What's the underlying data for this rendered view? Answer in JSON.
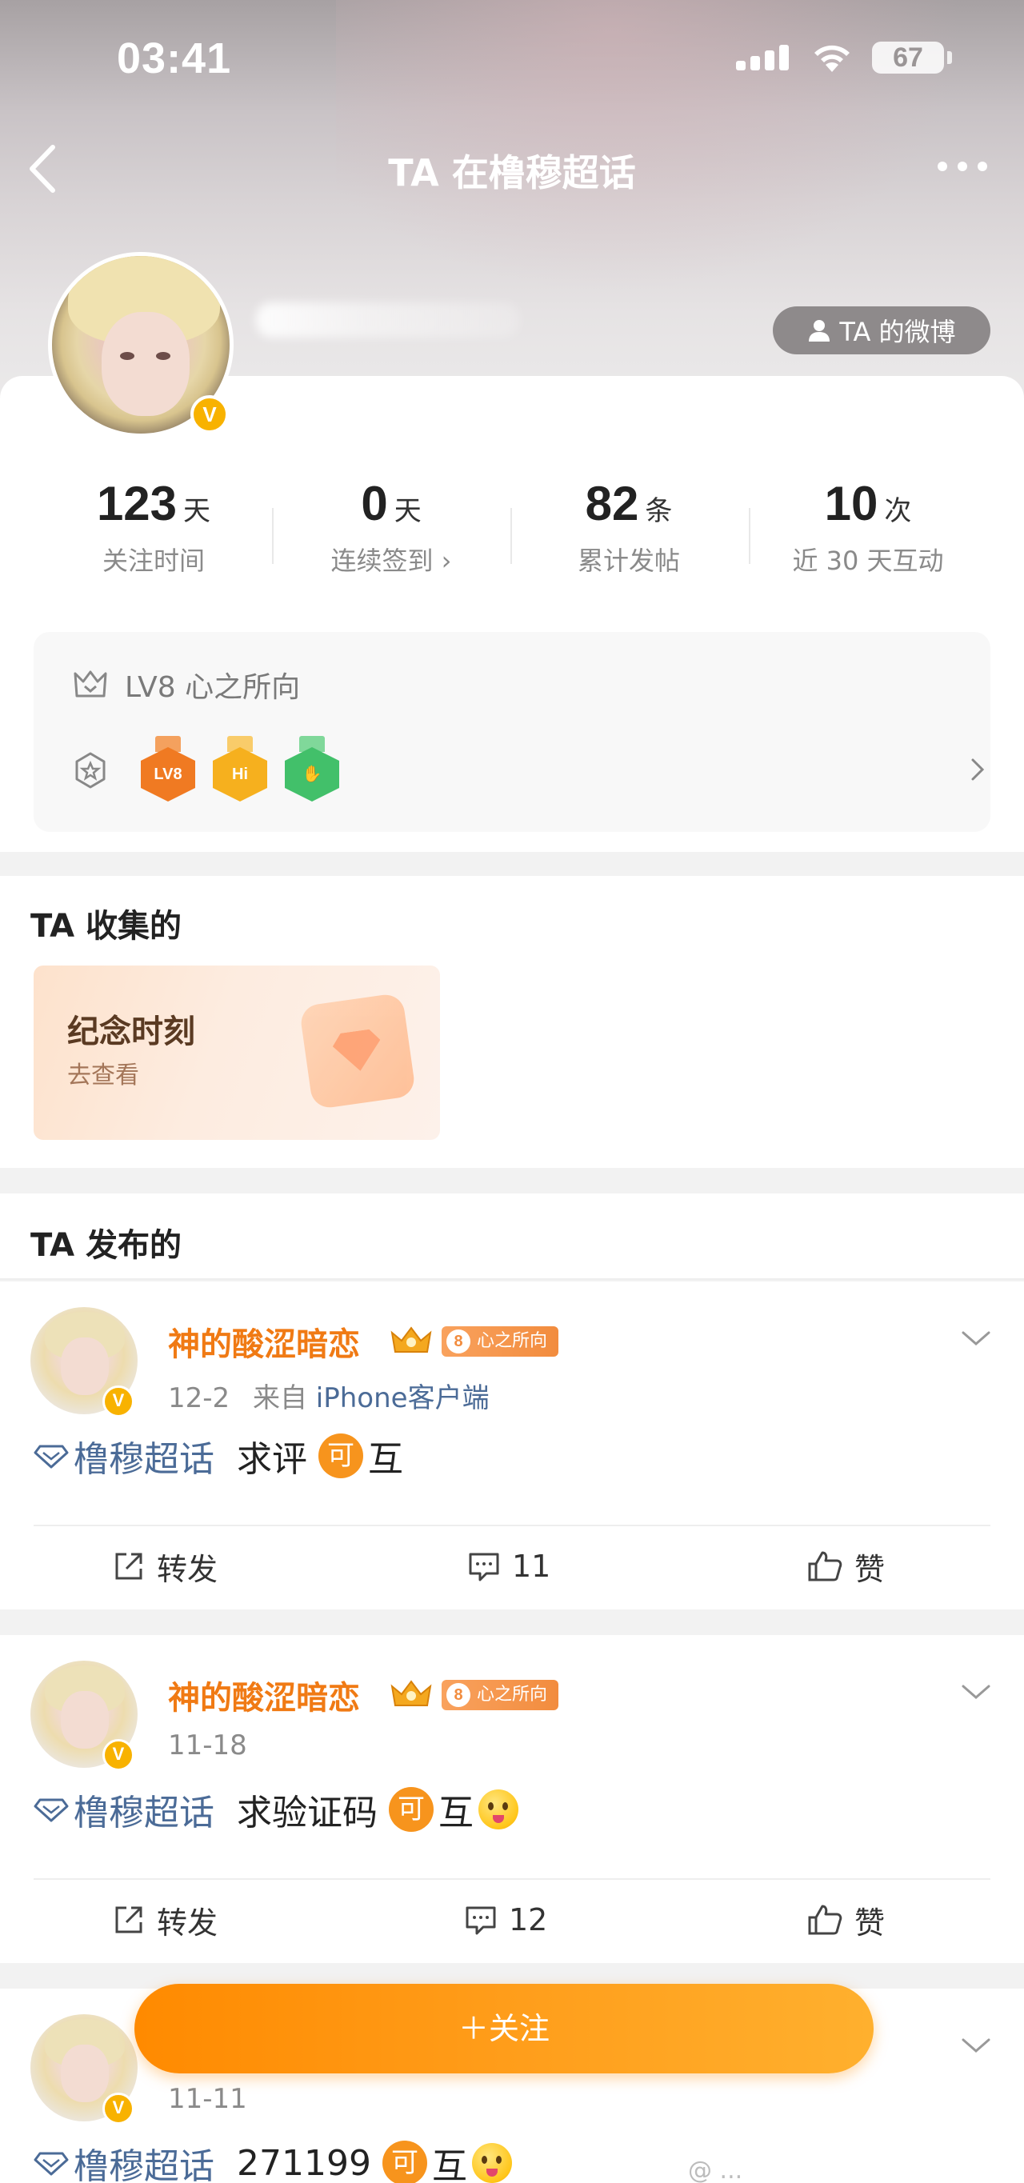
{
  "status_bar": {
    "time": "03:41",
    "battery": "67"
  },
  "nav": {
    "title": "TA 在橹穆超话"
  },
  "profile": {
    "ta_weibo_label": "TA 的微博",
    "verified_badge": "V",
    "stats": [
      {
        "value": "123",
        "unit": "天",
        "label": "关注时间"
      },
      {
        "value": "0",
        "unit": "天",
        "label": "连续签到 ›"
      },
      {
        "value": "82",
        "unit": "条",
        "label": "累计发帖"
      },
      {
        "value": "10",
        "unit": "次",
        "label": "近 30 天互动"
      }
    ],
    "level": "LV8 心之所向",
    "medals": [
      {
        "text": "LV8",
        "color": "#f07a22"
      },
      {
        "text": "Hi",
        "color": "#f6b01e"
      },
      {
        "text": "✋",
        "color": "#42c06a"
      }
    ]
  },
  "collected": {
    "title": "TA 收集的",
    "card_title": "纪念时刻",
    "card_sub": "去查看"
  },
  "published": {
    "title": "TA 发布的",
    "posts": [
      {
        "name": "神的酸涩暗恋",
        "level_num": "8",
        "level_name": "心之所向",
        "date": "12-2",
        "source_prefix": "来自",
        "source": "iPhone客户端",
        "topic": "橹穆超话",
        "text": "求评",
        "ke": "可",
        "tail": "互",
        "emoji": false,
        "repost": "转发",
        "comments": "11",
        "like": "赞"
      },
      {
        "name": "神的酸涩暗恋",
        "level_num": "8",
        "level_name": "心之所向",
        "date": "11-18",
        "source_prefix": "",
        "source": "",
        "topic": "橹穆超话",
        "text": "求验证码",
        "ke": "可",
        "tail": "互",
        "emoji": true,
        "repost": "转发",
        "comments": "12",
        "like": "赞"
      },
      {
        "name": "",
        "date": "11-11",
        "topic": "橹穆超话",
        "text": "271199",
        "ke": "可",
        "tail": "互",
        "emoji": true
      }
    ]
  },
  "follow_button": "＋关注",
  "colors": {
    "accent_orange": "#f07a14",
    "link_blue": "#4b6b97",
    "follow_gradient_start": "#ff8a00",
    "follow_gradient_end": "#ffb02e"
  }
}
